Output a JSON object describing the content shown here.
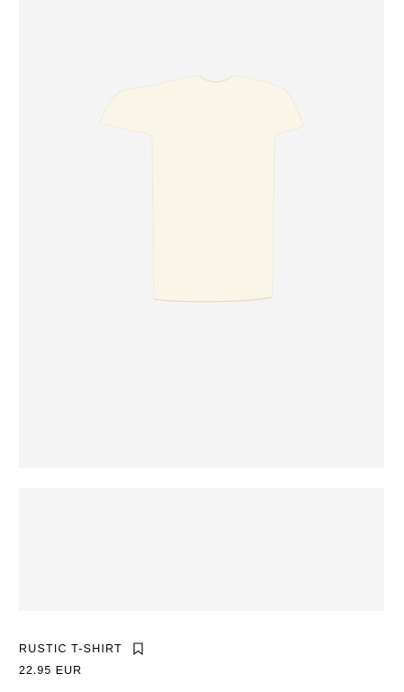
{
  "product": {
    "name": "RUSTIC T-SHIRT",
    "price": "22.95 EUR",
    "bookmark_icon": "bookmark-icon",
    "image_alt": "t-shirt-photo"
  },
  "colors": {
    "image_background": "#f5f4f5",
    "garment": "#f9f5e9",
    "placeholder_background": "#f5f5f5",
    "text": "#000000"
  }
}
